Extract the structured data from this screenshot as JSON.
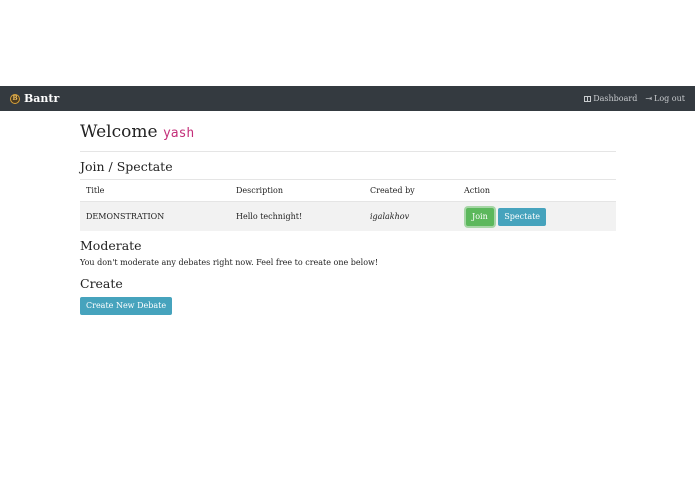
{
  "navbar": {
    "brand": "Bantr",
    "links": [
      {
        "label": "Dashboard",
        "icon": "dashboard-icon"
      },
      {
        "label": "Log out",
        "icon": "logout-icon"
      }
    ]
  },
  "welcome": {
    "prefix": "Welcome",
    "username": "yash"
  },
  "join": {
    "title": "Join / Spectate",
    "columns": [
      "Title",
      "Description",
      "Created by",
      "Action"
    ],
    "rows": [
      {
        "title": "DEMONSTRATION",
        "description": "Hello technight!",
        "created_by": "igalakhov",
        "join_label": "Join",
        "spectate_label": "Spectate"
      }
    ]
  },
  "moderate": {
    "title": "Moderate",
    "text": "You don't moderate any debates right now. Feel free to create one below!"
  },
  "create": {
    "title": "Create",
    "button_label": "Create New Debate"
  },
  "colors": {
    "navbar": "#343a40",
    "join_button": "#5cb85c",
    "info_button": "#46a3bd",
    "username": "#c4307a"
  }
}
